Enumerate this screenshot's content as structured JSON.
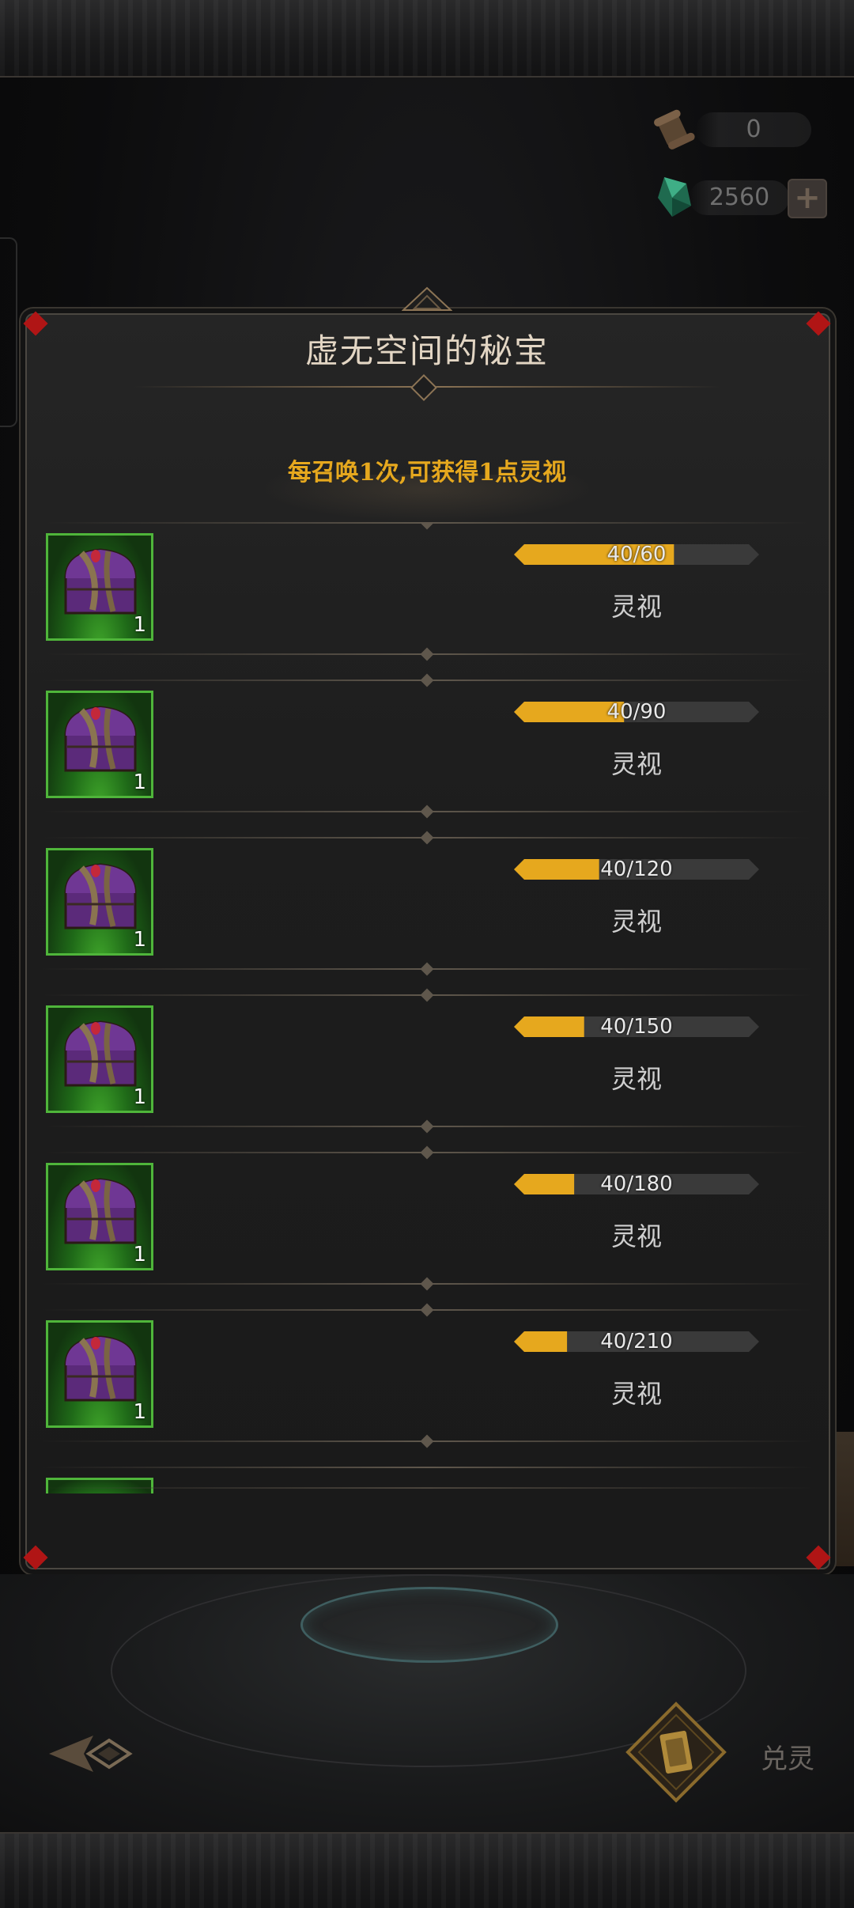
{
  "currency": {
    "scroll": {
      "icon": "scroll-icon",
      "amount": "0"
    },
    "gem": {
      "icon": "green-crystal-icon",
      "amount": "2560",
      "add_icon": "plus-icon"
    }
  },
  "panel": {
    "title": "虚无空间的秘宝",
    "subtitle": "每召唤1次,可获得1点灵视",
    "accent_color": "#e6a81e",
    "rows": [
      {
        "item_icon": "purple-chest-icon",
        "count": "1",
        "progress_text": "40/60",
        "current": 40,
        "target": 60,
        "reward_label": "灵视"
      },
      {
        "item_icon": "purple-chest-icon",
        "count": "1",
        "progress_text": "40/90",
        "current": 40,
        "target": 90,
        "reward_label": "灵视"
      },
      {
        "item_icon": "purple-chest-icon",
        "count": "1",
        "progress_text": "40/120",
        "current": 40,
        "target": 120,
        "reward_label": "灵视"
      },
      {
        "item_icon": "purple-chest-icon",
        "count": "1",
        "progress_text": "40/150",
        "current": 40,
        "target": 150,
        "reward_label": "灵视"
      },
      {
        "item_icon": "purple-chest-icon",
        "count": "1",
        "progress_text": "40/180",
        "current": 40,
        "target": 180,
        "reward_label": "灵视"
      },
      {
        "item_icon": "purple-chest-icon",
        "count": "1",
        "progress_text": "40/210",
        "current": 40,
        "target": 210,
        "reward_label": "灵视"
      }
    ]
  },
  "bottom": {
    "back_icon": "back-arrow-icon",
    "exchange_icon": "card-diamond-icon",
    "exchange_label": "兑灵"
  }
}
